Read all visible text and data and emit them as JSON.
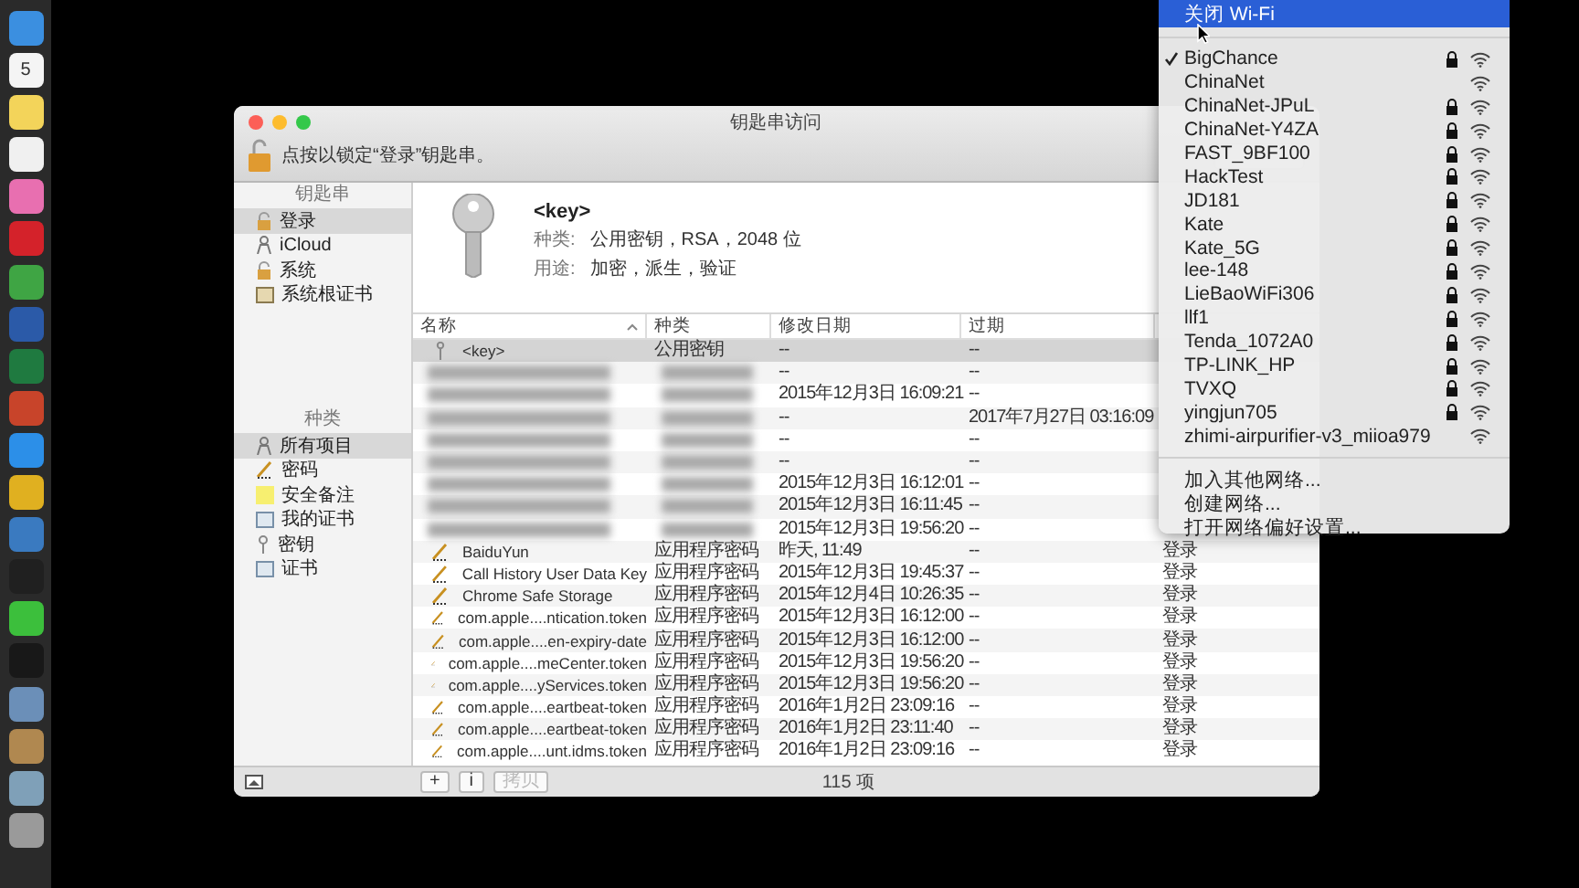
{
  "dock": {
    "items": [
      {
        "color": "#3b8fe0"
      },
      {
        "color": "#f4f4f4",
        "label": "5"
      },
      {
        "color": "#f3d45a"
      },
      {
        "color": "#f0f0f0"
      },
      {
        "color": "#e86fb0"
      },
      {
        "color": "#d4222a"
      },
      {
        "color": "#3fa544"
      },
      {
        "color": "#2b5aa8"
      },
      {
        "color": "#1f7a40"
      },
      {
        "color": "#c8442a"
      },
      {
        "color": "#2c8fe8"
      },
      {
        "color": "#e0b020"
      },
      {
        "color": "#3a7ac0"
      },
      {
        "color": "#202020"
      },
      {
        "color": "#3cbf3c"
      },
      {
        "color": "#181818"
      },
      {
        "color": "#6b8fb8"
      },
      {
        "color": "#b08850"
      },
      {
        "color": "#7fa0b8"
      },
      {
        "color": "#9a9a9a"
      }
    ]
  },
  "window": {
    "title": "钥匙串访问",
    "lock_hint": "点按以锁定“登录”钥匙串。"
  },
  "sidebar": {
    "keychains_header": "钥匙串",
    "keychains": [
      {
        "label": "登录",
        "kind": "lock",
        "selected": true
      },
      {
        "label": "iCloud",
        "kind": "person",
        "selected": false
      },
      {
        "label": "系统",
        "kind": "lock",
        "selected": false
      },
      {
        "label": "系统根证书",
        "kind": "cabinet",
        "selected": false
      }
    ],
    "categories_header": "种类",
    "categories": [
      {
        "label": "所有项目",
        "kind": "person",
        "selected": true
      },
      {
        "label": "密码",
        "kind": "pen",
        "selected": false
      },
      {
        "label": "安全备注",
        "kind": "note",
        "selected": false
      },
      {
        "label": "我的证书",
        "kind": "cert",
        "selected": false
      },
      {
        "label": "密钥",
        "kind": "key",
        "selected": false
      },
      {
        "label": "证书",
        "kind": "cert",
        "selected": false
      }
    ]
  },
  "detail": {
    "title": "<key>",
    "lines": [
      {
        "label": "种类:",
        "value": "公用密钥，RSA，2048 位"
      },
      {
        "label": "用途:",
        "value": "加密，派生，验证"
      }
    ]
  },
  "table": {
    "columns": [
      "名称",
      "种类",
      "修改日期",
      "过期"
    ],
    "rows": [
      {
        "kind": "key",
        "name": "<key>",
        "type": "公用密钥",
        "modified": "--",
        "expires": "--",
        "selected": true
      },
      {
        "kind": "blurred",
        "modified": "--",
        "expires": "--",
        "selected": false
      },
      {
        "kind": "blurred",
        "modified": "2015年12月3日 16:09:21",
        "expires": "--",
        "selected": false
      },
      {
        "kind": "blurred",
        "modified": "--",
        "expires": "2017年7月27日 03:16:09",
        "selected": false
      },
      {
        "kind": "blurred",
        "modified": "--",
        "expires": "--",
        "selected": false
      },
      {
        "kind": "blurred",
        "modified": "--",
        "expires": "--",
        "selected": false
      },
      {
        "kind": "blurred",
        "modified": "2015年12月3日 16:12:01",
        "expires": "--",
        "selected": false
      },
      {
        "kind": "blurred",
        "modified": "2015年12月3日 16:11:45",
        "expires": "--",
        "selected": false
      },
      {
        "kind": "blurred",
        "modified": "2015年12月3日 19:56:20",
        "expires": "--",
        "selected": false
      },
      {
        "kind": "password",
        "name": "BaiduYun",
        "type": "应用程序密码",
        "modified": "昨天, 11:49",
        "expires": "--",
        "keychain": "登录",
        "selected": false
      },
      {
        "kind": "password",
        "name": "Call History User Data Key",
        "type": "应用程序密码",
        "modified": "2015年12月3日 19:45:37",
        "expires": "--",
        "keychain": "登录",
        "selected": false
      },
      {
        "kind": "password",
        "name": "Chrome Safe Storage",
        "type": "应用程序密码",
        "modified": "2015年12月4日 10:26:35",
        "expires": "--",
        "keychain": "登录",
        "selected": false
      },
      {
        "kind": "password",
        "name": "com.apple....ntication.token",
        "type": "应用程序密码",
        "modified": "2015年12月3日 16:12:00",
        "expires": "--",
        "keychain": "登录",
        "selected": false
      },
      {
        "kind": "password",
        "name": "com.apple....en-expiry-date",
        "type": "应用程序密码",
        "modified": "2015年12月3日 16:12:00",
        "expires": "--",
        "keychain": "登录",
        "selected": false
      },
      {
        "kind": "password",
        "name": "com.apple....meCenter.token",
        "type": "应用程序密码",
        "modified": "2015年12月3日 19:56:20",
        "expires": "--",
        "keychain": "登录",
        "selected": false
      },
      {
        "kind": "password",
        "name": "com.apple....yServices.token",
        "type": "应用程序密码",
        "modified": "2015年12月3日 19:56:20",
        "expires": "--",
        "keychain": "登录",
        "selected": false
      },
      {
        "kind": "password",
        "name": "com.apple....eartbeat-token",
        "type": "应用程序密码",
        "modified": "2016年1月2日 23:09:16",
        "expires": "--",
        "keychain": "登录",
        "selected": false
      },
      {
        "kind": "password",
        "name": "com.apple....eartbeat-token",
        "type": "应用程序密码",
        "modified": "2016年1月2日 23:11:40",
        "expires": "--",
        "keychain": "登录",
        "selected": false
      },
      {
        "kind": "password",
        "name": "com.apple....unt.idms.token",
        "type": "应用程序密码",
        "modified": "2016年1月2日 23:09:16",
        "expires": "--",
        "keychain": "登录",
        "selected": false
      }
    ]
  },
  "bottom_bar": {
    "buttons": [
      {
        "label": "+",
        "disabled": false
      },
      {
        "label": "i",
        "disabled": false
      },
      {
        "label": "拷贝",
        "disabled": true
      }
    ],
    "count": "115 项"
  },
  "wifi_menu": {
    "top_item": {
      "label": "关闭 Wi-Fi",
      "selected": true
    },
    "networks": [
      {
        "name": "BigChance",
        "connected": true,
        "locked": true
      },
      {
        "name": "ChinaNet",
        "connected": false,
        "locked": false
      },
      {
        "name": "ChinaNet-JPuL",
        "connected": false,
        "locked": true
      },
      {
        "name": "ChinaNet-Y4ZA",
        "connected": false,
        "locked": true
      },
      {
        "name": "FAST_9BF100",
        "connected": false,
        "locked": true
      },
      {
        "name": "HackTest",
        "connected": false,
        "locked": true
      },
      {
        "name": "JD181",
        "connected": false,
        "locked": true
      },
      {
        "name": "Kate",
        "connected": false,
        "locked": true
      },
      {
        "name": "Kate_5G",
        "connected": false,
        "locked": true
      },
      {
        "name": "lee-148",
        "connected": false,
        "locked": true
      },
      {
        "name": "LieBaoWiFi306",
        "connected": false,
        "locked": true
      },
      {
        "name": "llf1",
        "connected": false,
        "locked": true
      },
      {
        "name": "Tenda_1072A0",
        "connected": false,
        "locked": true
      },
      {
        "name": "TP-LINK_HP",
        "connected": false,
        "locked": true
      },
      {
        "name": "TVXQ",
        "connected": false,
        "locked": true
      },
      {
        "name": "yingjun705",
        "connected": false,
        "locked": true
      },
      {
        "name": "zhimi-airpurifier-v3_miioa979",
        "connected": false,
        "locked": false
      }
    ],
    "actions": [
      {
        "label": "加入其他网络...",
        "selected": false
      },
      {
        "label": "创建网络...",
        "selected": false
      },
      {
        "label": "打开网络偏好设置...",
        "selected": false
      }
    ]
  }
}
